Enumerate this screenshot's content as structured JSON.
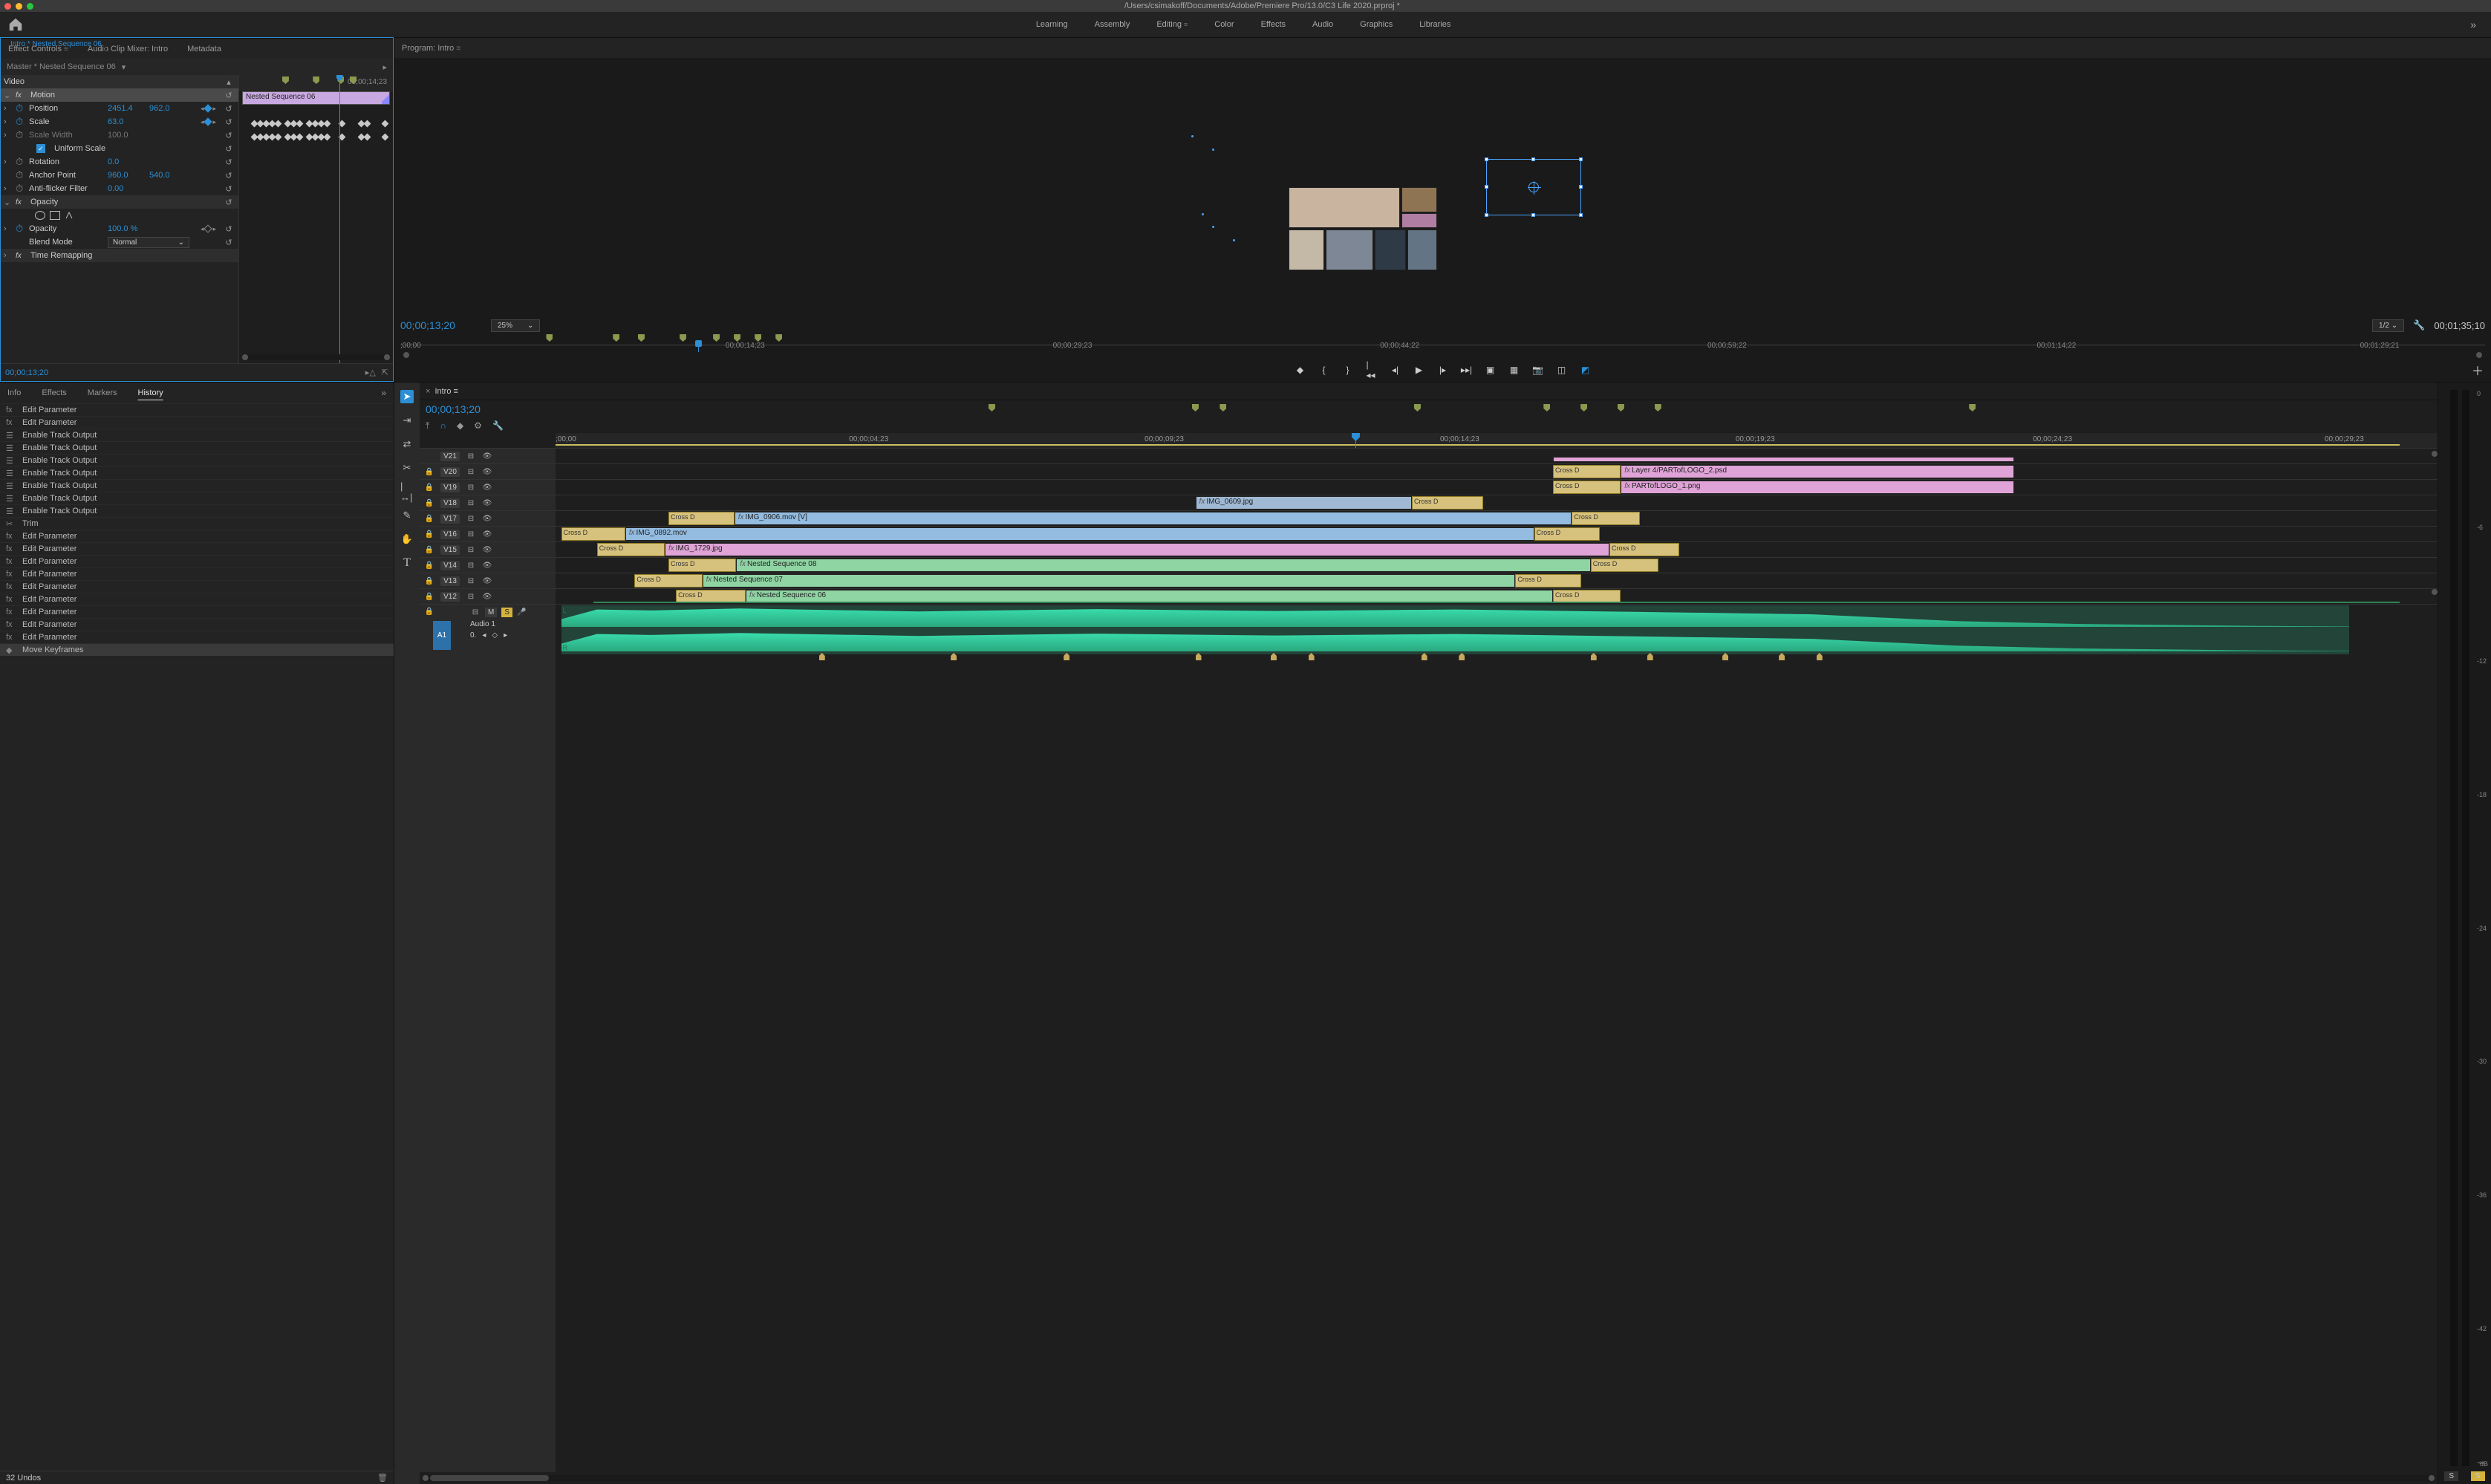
{
  "window": {
    "title": "/Users/csimakoff/Documents/Adobe/Premiere Pro/13.0/C3 Life 2020.prproj *"
  },
  "workspaces": [
    "Learning",
    "Assembly",
    "Editing",
    "Color",
    "Effects",
    "Audio",
    "Graphics",
    "Libraries"
  ],
  "workspace_active": "Editing",
  "effect_controls": {
    "tabs": [
      "Effect Controls",
      "Audio Clip Mixer: Intro",
      "Metadata"
    ],
    "tab_active": "Effect Controls",
    "master": "Master * Nested Sequence 06",
    "clip": "Intro * Nested Sequence 06",
    "clip_label": "Nested Sequence 06",
    "ruler_end": "00;00;14;23",
    "video_label": "Video",
    "timecode": "00;00;13;20",
    "props": {
      "motion": "Motion",
      "position": "Position",
      "position_x": "2451.4",
      "position_y": "962.0",
      "scale": "Scale",
      "scale_val": "63.0",
      "scale_width": "Scale Width",
      "scale_width_val": "100.0",
      "uniform": "Uniform Scale",
      "rotation": "Rotation",
      "rotation_val": "0.0",
      "anchor": "Anchor Point",
      "anchor_x": "960.0",
      "anchor_y": "540.0",
      "flicker": "Anti-flicker Filter",
      "flicker_val": "0.00",
      "opacity_sec": "Opacity",
      "opacity": "Opacity",
      "opacity_val": "100.0 %",
      "blend": "Blend Mode",
      "blend_val": "Normal",
      "time_remap": "Time Remapping"
    }
  },
  "program": {
    "tab": "Program: Intro",
    "timecode": "00;00;13;20",
    "zoom": "25%",
    "resolution": "1/2",
    "duration": "00;01;35;10",
    "ruler": [
      ";00;00",
      "00;00;14;23",
      "00;00;29;23",
      "00;00;44;22",
      "00;00;59;22",
      "00;01;14;22",
      "00;01;29;21"
    ]
  },
  "bottom_left": {
    "tabs": [
      "Info",
      "Effects",
      "Markers",
      "History"
    ],
    "tab_active": "History",
    "items": [
      {
        "ico": "fx",
        "label": "Edit Parameter"
      },
      {
        "ico": "fx",
        "label": "Edit Parameter"
      },
      {
        "ico": "trk",
        "label": "Enable Track Output"
      },
      {
        "ico": "trk",
        "label": "Enable Track Output"
      },
      {
        "ico": "trk",
        "label": "Enable Track Output"
      },
      {
        "ico": "trk",
        "label": "Enable Track Output"
      },
      {
        "ico": "trk",
        "label": "Enable Track Output"
      },
      {
        "ico": "trk",
        "label": "Enable Track Output"
      },
      {
        "ico": "trk",
        "label": "Enable Track Output"
      },
      {
        "ico": "trim",
        "label": "Trim"
      },
      {
        "ico": "fx",
        "label": "Edit Parameter"
      },
      {
        "ico": "fx",
        "label": "Edit Parameter"
      },
      {
        "ico": "fx",
        "label": "Edit Parameter"
      },
      {
        "ico": "fx",
        "label": "Edit Parameter"
      },
      {
        "ico": "fx",
        "label": "Edit Parameter"
      },
      {
        "ico": "fx",
        "label": "Edit Parameter"
      },
      {
        "ico": "fx",
        "label": "Edit Parameter"
      },
      {
        "ico": "fx",
        "label": "Edit Parameter"
      },
      {
        "ico": "fx",
        "label": "Edit Parameter"
      },
      {
        "ico": "kf",
        "label": "Move Keyframes"
      }
    ],
    "undos": "32 Undos"
  },
  "timeline": {
    "tab": "Intro",
    "timecode": "00;00;13;20",
    "ruler": [
      ";00;00",
      "00;00;04;23",
      "00;00;09;23",
      "00;00;14;23",
      "00;00;19;23",
      "00;00;24;23",
      "00;00;29;23"
    ],
    "tracks": [
      "V21",
      "V20",
      "V19",
      "V18",
      "V17",
      "V16",
      "V15",
      "V14",
      "V13",
      "V12"
    ],
    "audio_track": "A1",
    "audio_label": "Audio 1",
    "audio_m": "M",
    "audio_s": "S",
    "audio_zero": "0.",
    "clips": {
      "v20a": "Layer 4/PARTofLOGO_2.psd",
      "v19a": "PARTofLOGO_1.png",
      "v18a": "IMG_0609.jpg",
      "v17a": "IMG_0906.mov [V]",
      "v16a": "IMG_0892.mov",
      "v15a": "IMG_1729.jpg",
      "v14a": "Nested Sequence 08",
      "v13a": "Nested Sequence 07",
      "v12a": "Nested Sequence 06",
      "cross": "Cross D"
    }
  },
  "meters": {
    "db_label": "dB",
    "scale": [
      "0",
      "-6",
      "-12",
      "-18",
      "-24",
      "-30",
      "-36",
      "-42",
      "-∞"
    ],
    "solo": "S"
  }
}
